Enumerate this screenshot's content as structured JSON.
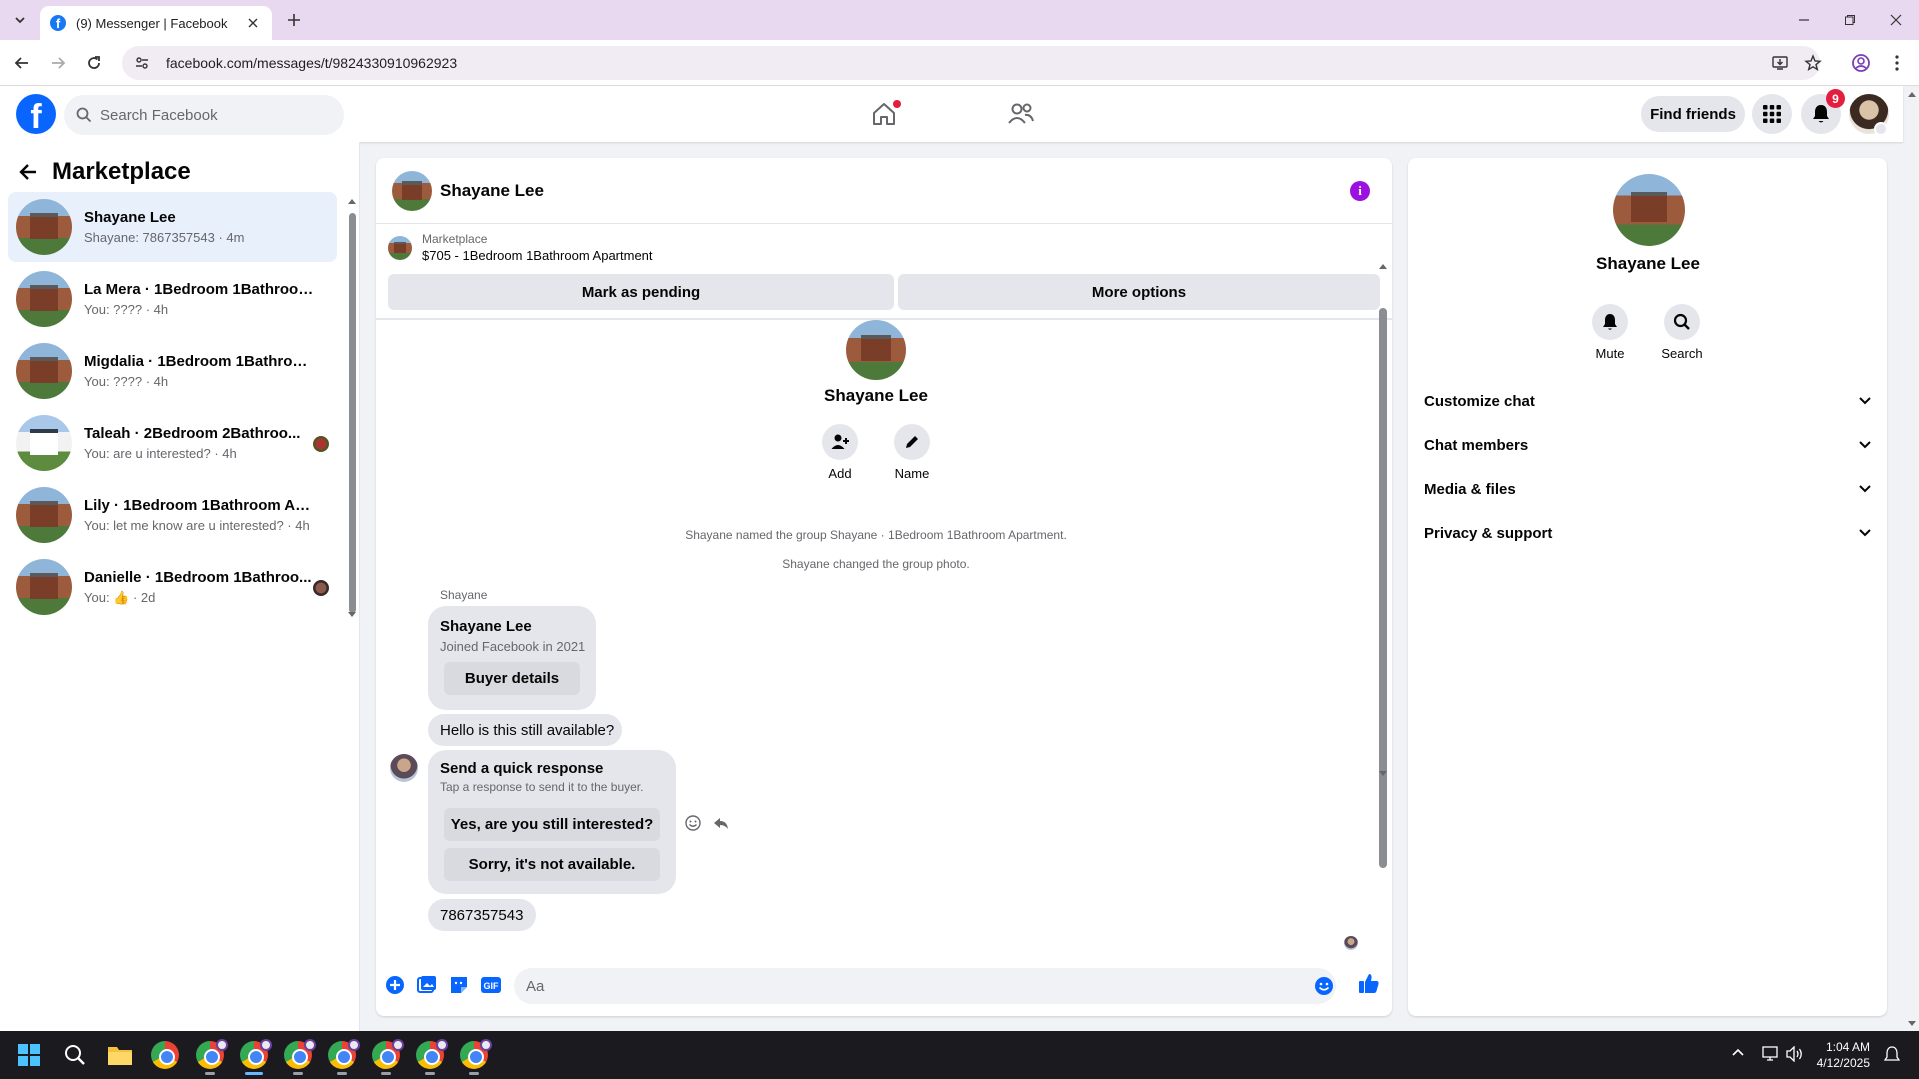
{
  "browser": {
    "tab_title": "(9) Messenger | Facebook",
    "url": "facebook.com/messages/t/9824330910962923"
  },
  "fb_header": {
    "search_placeholder": "Search Facebook",
    "find_friends_label": "Find friends",
    "notification_count": "9"
  },
  "left_panel": {
    "title": "Marketplace",
    "conversations": [
      {
        "name": "Shayane Lee",
        "preview": "Shayane: 7867357543 · 4m",
        "active": true
      },
      {
        "name": "La Mera · 1Bedroom 1Bathroom ...",
        "preview": "You: ???? · 4h"
      },
      {
        "name": "Migdalia · 1Bedroom 1Bathroom...",
        "preview": "You: ???? · 4h"
      },
      {
        "name": "Taleah · 2Bedroom 2Bathroo...",
        "preview": "You: are u interested? · 4h"
      },
      {
        "name": "Lily · 1Bedroom 1Bathroom Apar...",
        "preview": "You: let me know are u interested? · 4h"
      },
      {
        "name": "Danielle · 1Bedroom 1Bathroo...",
        "preview": "You: 👍 · 2d"
      }
    ]
  },
  "chat": {
    "header_name": "Shayane Lee",
    "listing_category": "Marketplace",
    "listing_title": "$705 - 1Bedroom 1Bathroom Apartment",
    "mark_pending_label": "Mark as pending",
    "more_options_label": "More options",
    "intro_name": "Shayane Lee",
    "add_label": "Add",
    "name_label": "Name",
    "system_messages": [
      "Shayane named the group Shayane · 1Bedroom 1Bathroom Apartment.",
      "Shayane changed the group photo."
    ],
    "sender_label": "Shayane",
    "profile_card": {
      "name": "Shayane Lee",
      "joined": "Joined Facebook in 2021",
      "button": "Buyer details"
    },
    "message_1": "Hello is this still available?",
    "quick_response": {
      "title": "Send a quick response",
      "subtitle": "Tap a response to send it to the buyer.",
      "option_1": "Yes, are you still interested?",
      "option_2": "Sorry, it's not available."
    },
    "message_2": "7867357543",
    "composer_placeholder": "Aa"
  },
  "right_panel": {
    "name": "Shayane Lee",
    "mute_label": "Mute",
    "search_label": "Search",
    "sections": [
      "Customize chat",
      "Chat members",
      "Media & files",
      "Privacy & support"
    ]
  },
  "taskbar": {
    "time": "1:04 AM",
    "date": "4/12/2025"
  },
  "colors": {
    "brand_blue": "#0866ff",
    "info_purple": "#9b12e0",
    "badge_red": "#e41e3f"
  }
}
